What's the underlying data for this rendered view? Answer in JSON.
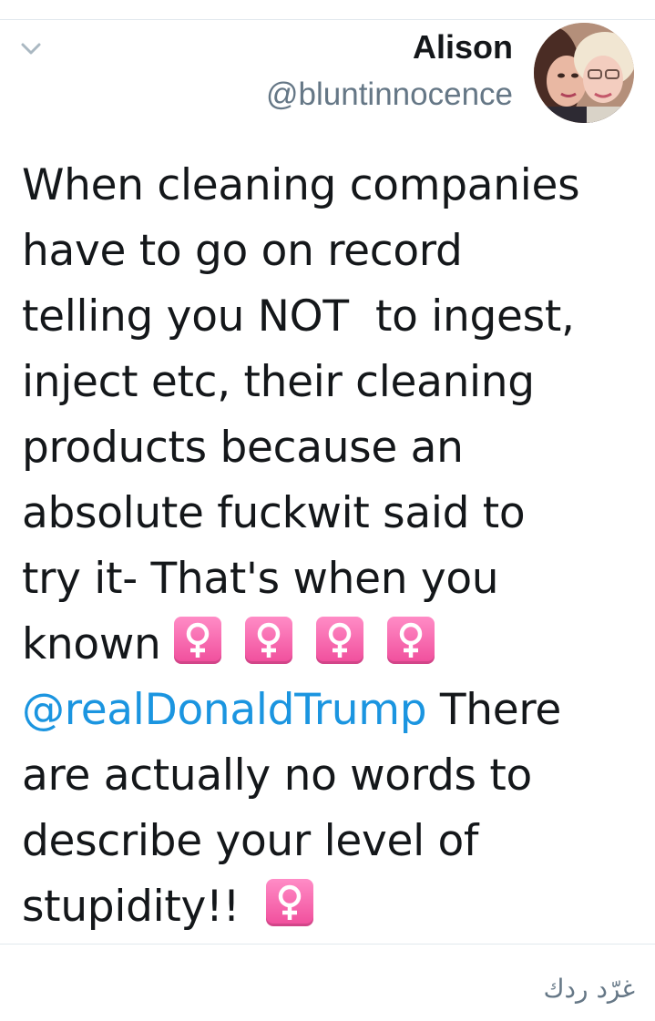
{
  "tweet": {
    "author": {
      "name": "Alison",
      "handle": "@bluntinnocence",
      "avatar_icon": "profile-photo"
    },
    "text_lines": [
      "When cleaning companies",
      "have to go on record",
      "telling you NOT  to ingest,",
      "inject etc, their cleaning",
      "products because an",
      "absolute fuckwit said to",
      "try it- That's when you"
    ],
    "line8_text": "known",
    "emoji_name": "female-sign-emoji",
    "mention": "@realDonaldTrump",
    "mention_trail": " There",
    "text_lines_after": [
      "are actually no words to",
      "describe your level of"
    ],
    "last_line_text": "stupidity!!  ",
    "reply_label": "غرّد ردك"
  },
  "colors": {
    "text": "#14171a",
    "secondary": "#657786",
    "link": "#1b95e0",
    "divider": "#e1e8ed",
    "emoji": "#f04d9b"
  }
}
